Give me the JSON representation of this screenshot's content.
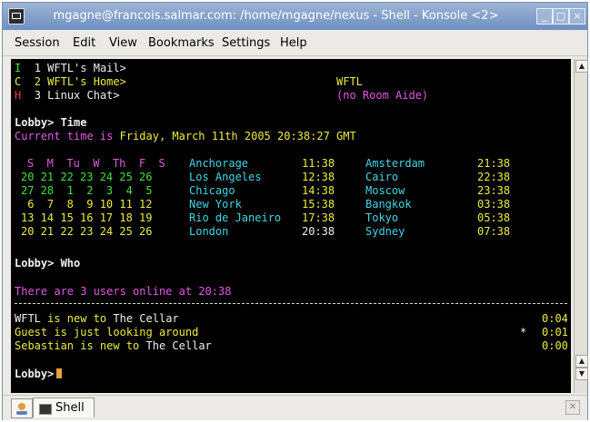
{
  "window": {
    "title": "mgagne@francois.salmar.com: /home/mgagne/nexus - Shell - Konsole <2>",
    "buttons": {
      "minimize": "_",
      "maximize": "□",
      "close": "×"
    }
  },
  "menubar": [
    "Session",
    "Edit",
    "View",
    "Bookmarks",
    "Settings",
    "Help"
  ],
  "colors": {
    "background": "#000000",
    "white": "#f0f0f0",
    "green": "#3ee43e",
    "yellow": "#ecec40",
    "magenta": "#e05ae0",
    "cyan": "#40d8e8",
    "red": "#e84040",
    "cursor": "#e8a040"
  },
  "terminal": {
    "header": [
      {
        "key": "I",
        "num": "1",
        "label": "WFTL's Mail>"
      },
      {
        "key": "C",
        "num": "2",
        "label": "WFTL's Home>"
      },
      {
        "key": "H",
        "num": "3",
        "label": "Linux Chat>"
      }
    ],
    "room_name": "WFTL",
    "room_aide": "(no Room Aide)",
    "prompt_time": "Lobby> Time",
    "current_time_label": "Current time is",
    "current_time_value": "Friday, March 11th 2005 20:38:27 GMT",
    "calendar": [
      "S  M  Tu  W  Th  F  S",
      "20 21 22 23 24 25 26",
      "27 28  1  2  3  4  5",
      " 6  7  8  9 10 11 12",
      "13 14 15 16 17 18 19",
      "20 21 22 23 24 25 26"
    ],
    "cities_left": [
      {
        "city": "Anchorage",
        "time": "11:38"
      },
      {
        "city": "Los Angeles",
        "time": "12:38"
      },
      {
        "city": "Chicago",
        "time": "14:38"
      },
      {
        "city": "New York",
        "time": "15:38"
      },
      {
        "city": "Rio de Janeiro",
        "time": "17:38"
      },
      {
        "city": "London",
        "time": "20:38"
      }
    ],
    "cities_right": [
      {
        "city": "Amsterdam",
        "time": "21:38"
      },
      {
        "city": "Cairo",
        "time": "22:38"
      },
      {
        "city": "Moscow",
        "time": "23:38"
      },
      {
        "city": "Bangkok",
        "time": "03:38"
      },
      {
        "city": "Tokyo",
        "time": "05:38"
      },
      {
        "city": "Sydney",
        "time": "07:38"
      }
    ],
    "prompt_who": "Lobby> Who",
    "users_online": "There are 3 users online at 20:38",
    "users": [
      {
        "name": "WFTL",
        "status": " is new to ",
        "place": "The Cellar",
        "marker": "",
        "idle": "0:04"
      },
      {
        "name": "Guest",
        "status": " is just looking around",
        "place": "",
        "marker": "*",
        "idle": "0:01"
      },
      {
        "name": "Sebastian",
        "status": " is new to ",
        "place": "The Cellar",
        "marker": "",
        "idle": "0:00"
      }
    ],
    "prompt_final": "Lobby>"
  },
  "tabbar": {
    "tab_label": "Shell"
  }
}
